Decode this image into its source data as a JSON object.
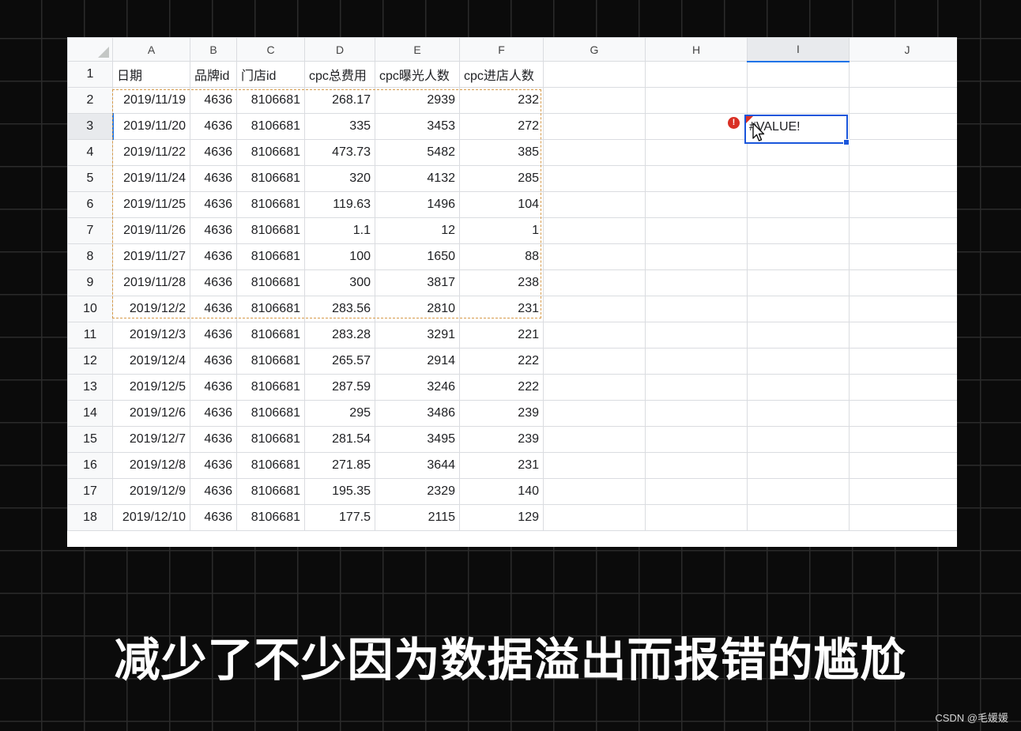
{
  "sheet": {
    "columns": [
      {
        "letter": "A"
      },
      {
        "letter": "B"
      },
      {
        "letter": "C"
      },
      {
        "letter": "D"
      },
      {
        "letter": "E"
      },
      {
        "letter": "F"
      },
      {
        "letter": "G"
      },
      {
        "letter": "H"
      },
      {
        "letter": "I"
      },
      {
        "letter": "J"
      }
    ],
    "header_row": {
      "number": "1",
      "cells": [
        "日期",
        "品牌id",
        "门店id",
        "cpc总费用",
        "cpc曝光人数",
        "cpc进店人数"
      ]
    },
    "rows": [
      {
        "number": "2",
        "cells": [
          "2019/11/19",
          "4636",
          "8106681",
          "268.17",
          "2939",
          "232"
        ]
      },
      {
        "number": "3",
        "cells": [
          "2019/11/20",
          "4636",
          "8106681",
          "335",
          "3453",
          "272"
        ]
      },
      {
        "number": "4",
        "cells": [
          "2019/11/22",
          "4636",
          "8106681",
          "473.73",
          "5482",
          "385"
        ]
      },
      {
        "number": "5",
        "cells": [
          "2019/11/24",
          "4636",
          "8106681",
          "320",
          "4132",
          "285"
        ]
      },
      {
        "number": "6",
        "cells": [
          "2019/11/25",
          "4636",
          "8106681",
          "119.63",
          "1496",
          "104"
        ]
      },
      {
        "number": "7",
        "cells": [
          "2019/11/26",
          "4636",
          "8106681",
          "1.1",
          "12",
          "1"
        ]
      },
      {
        "number": "8",
        "cells": [
          "2019/11/27",
          "4636",
          "8106681",
          "100",
          "1650",
          "88"
        ]
      },
      {
        "number": "9",
        "cells": [
          "2019/11/28",
          "4636",
          "8106681",
          "300",
          "3817",
          "238"
        ]
      },
      {
        "number": "10",
        "cells": [
          "2019/12/2",
          "4636",
          "8106681",
          "283.56",
          "2810",
          "231"
        ]
      },
      {
        "number": "11",
        "cells": [
          "2019/12/3",
          "4636",
          "8106681",
          "283.28",
          "3291",
          "221"
        ]
      },
      {
        "number": "12",
        "cells": [
          "2019/12/4",
          "4636",
          "8106681",
          "265.57",
          "2914",
          "222"
        ]
      },
      {
        "number": "13",
        "cells": [
          "2019/12/5",
          "4636",
          "8106681",
          "287.59",
          "3246",
          "222"
        ]
      },
      {
        "number": "14",
        "cells": [
          "2019/12/6",
          "4636",
          "8106681",
          "295",
          "3486",
          "239"
        ]
      },
      {
        "number": "15",
        "cells": [
          "2019/12/7",
          "4636",
          "8106681",
          "281.54",
          "3495",
          "239"
        ]
      },
      {
        "number": "16",
        "cells": [
          "2019/12/8",
          "4636",
          "8106681",
          "271.85",
          "3644",
          "231"
        ]
      },
      {
        "number": "17",
        "cells": [
          "2019/12/9",
          "4636",
          "8106681",
          "195.35",
          "2329",
          "140"
        ]
      },
      {
        "number": "18",
        "cells": [
          "2019/12/10",
          "4636",
          "8106681",
          "177.5",
          "2115",
          "129"
        ]
      }
    ],
    "active_cell": {
      "value": "#VALUE!"
    },
    "error_icon": {
      "glyph": "!",
      "icon": "error-icon"
    },
    "colors": {
      "selection": "#1a56db",
      "copy_marquee": "#d69a4a",
      "error": "#d93025",
      "gridline": "#dadce0"
    }
  },
  "caption": "减少了不少因为数据溢出而报错的尴尬",
  "watermark": "CSDN @毛媛媛"
}
